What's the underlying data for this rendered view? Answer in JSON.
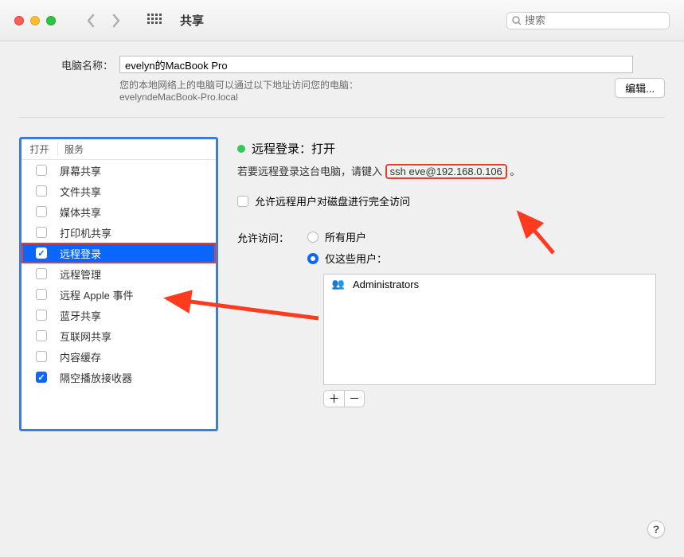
{
  "toolbar": {
    "title": "共享",
    "search_placeholder": "搜索"
  },
  "computer_name": {
    "label": "电脑名称：",
    "value": "evelyn的MacBook Pro",
    "sub_line1": "您的本地网络上的电脑可以通过以下地址访问您的电脑：",
    "sub_line2": "evelyndeMacBook-Pro.local",
    "edit_label": "编辑..."
  },
  "services": {
    "header_on": "打开",
    "header_name": "服务",
    "items": [
      {
        "label": "屏幕共享",
        "checked": false,
        "selected": false
      },
      {
        "label": "文件共享",
        "checked": false,
        "selected": false
      },
      {
        "label": "媒体共享",
        "checked": false,
        "selected": false
      },
      {
        "label": "打印机共享",
        "checked": false,
        "selected": false
      },
      {
        "label": "远程登录",
        "checked": true,
        "selected": true
      },
      {
        "label": "远程管理",
        "checked": false,
        "selected": false
      },
      {
        "label": "远程 Apple 事件",
        "checked": false,
        "selected": false
      },
      {
        "label": "蓝牙共享",
        "checked": false,
        "selected": false
      },
      {
        "label": "互联网共享",
        "checked": false,
        "selected": false
      },
      {
        "label": "内容缓存",
        "checked": false,
        "selected": false
      },
      {
        "label": "隔空播放接收器",
        "checked": true,
        "selected": false
      }
    ]
  },
  "detail": {
    "status_label": "远程登录：打开",
    "instruction_prefix": "若要远程登录这台电脑，请键入",
    "ssh_command": "ssh eve@192.168.0.106",
    "instruction_suffix": "。",
    "full_disk_label": "允许远程用户对磁盘进行完全访问",
    "allow_label": "允许访问：",
    "radio_all": "所有用户",
    "radio_only": "仅这些用户：",
    "users": [
      {
        "name": "Administrators",
        "icon": "👥"
      }
    ]
  },
  "annotations": {
    "highlight_color": "#e63c2e",
    "arrow_color": "#ff3b1f"
  }
}
